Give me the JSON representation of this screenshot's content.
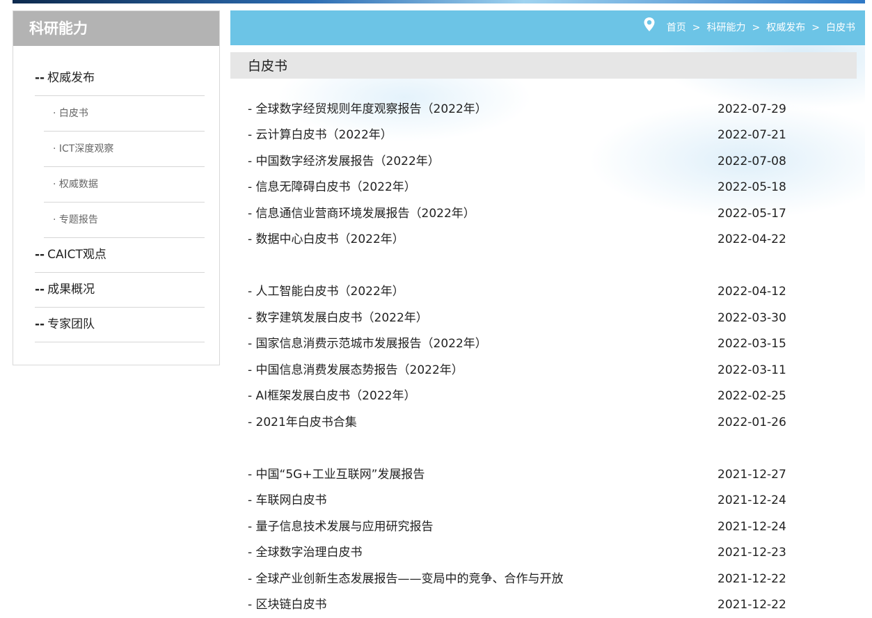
{
  "sidebar": {
    "title": "科研能力",
    "menu": [
      {
        "dash": "--",
        "label": "权威发布"
      },
      {
        "dash": "--",
        "label": "CAICT观点"
      },
      {
        "dash": "--",
        "label": "成果概况"
      },
      {
        "dash": "--",
        "label": "专家团队"
      }
    ],
    "submenu": [
      {
        "bullet": "·",
        "label": "白皮书"
      },
      {
        "bullet": "·",
        "label": "ICT深度观察"
      },
      {
        "bullet": "·",
        "label": "权威数据"
      },
      {
        "bullet": "·",
        "label": "专题报告"
      }
    ]
  },
  "breadcrumb": {
    "items": [
      "首页",
      "科研能力",
      "权威发布",
      "白皮书"
    ],
    "separator": ">"
  },
  "section": {
    "title": "白皮书"
  },
  "articles": [
    {
      "title": "- 全球数字经贸规则年度观察报告（2022年）",
      "date": "2022-07-29"
    },
    {
      "title": "- 云计算白皮书（2022年）",
      "date": "2022-07-21"
    },
    {
      "title": "- 中国数字经济发展报告（2022年）",
      "date": "2022-07-08"
    },
    {
      "title": "- 信息无障碍白皮书（2022年）",
      "date": "2022-05-18"
    },
    {
      "title": "- 信息通信业营商环境发展报告（2022年）",
      "date": "2022-05-17"
    },
    {
      "title": "- 数据中心白皮书（2022年）",
      "date": "2022-04-22"
    },
    {
      "title": "- 人工智能白皮书（2022年）",
      "date": "2022-04-12"
    },
    {
      "title": "- 数字建筑发展白皮书（2022年）",
      "date": "2022-03-30"
    },
    {
      "title": "- 国家信息消费示范城市发展报告（2022年）",
      "date": "2022-03-15"
    },
    {
      "title": "- 中国信息消费发展态势报告（2022年）",
      "date": "2022-03-11"
    },
    {
      "title": "- AI框架发展白皮书（2022年）",
      "date": "2022-02-25"
    },
    {
      "title": "- 2021年白皮书合集",
      "date": "2022-01-26"
    },
    {
      "title": "- 中国“5G+工业互联网”发展报告",
      "date": "2021-12-27"
    },
    {
      "title": "- 车联网白皮书",
      "date": "2021-12-24"
    },
    {
      "title": "- 量子信息技术发展与应用研究报告",
      "date": "2021-12-24"
    },
    {
      "title": "- 全球数字治理白皮书",
      "date": "2021-12-23"
    },
    {
      "title": "- 全球产业创新生态发展报告——变局中的竞争、合作与开放",
      "date": "2021-12-22"
    },
    {
      "title": "- 区块链白皮书",
      "date": "2021-12-22"
    }
  ],
  "colors": {
    "breadcrumb_bar": "#6cc4e6",
    "sidebar_header": "#b3b3b3",
    "section_header": "#e6e6e6"
  }
}
